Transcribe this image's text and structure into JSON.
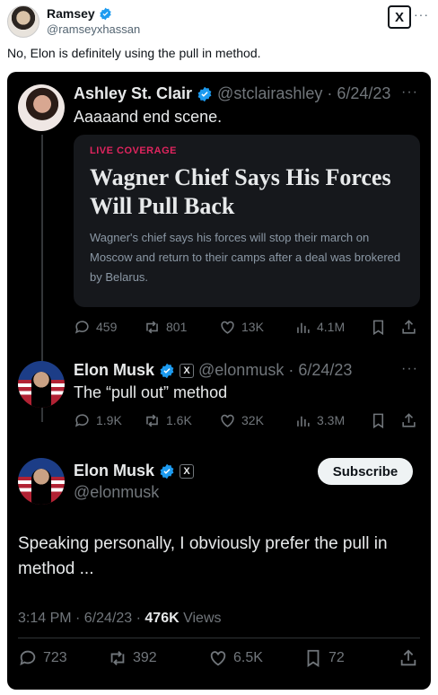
{
  "outer": {
    "name": "Ramsey",
    "handle": "@ramseyxhassan",
    "logo": "X",
    "text": "No, Elon is definitely using the pull in method."
  },
  "quoted_ashley": {
    "name": "Ashley St. Clair",
    "handle_date": "@stclairashley · 6/24/23",
    "text": "Aaaaand end scene.",
    "article": {
      "kicker": "LIVE COVERAGE",
      "title": "Wagner Chief Says His Forces Will Pull Back",
      "summary": "Wagner's chief says his forces will stop their march on Moscow and return to their camps after a deal was brokered by Belarus."
    },
    "stats": {
      "replies": "459",
      "reposts": "801",
      "likes": "13K",
      "views": "4.1M"
    }
  },
  "reply_elon": {
    "name": "Elon Musk",
    "handle_date": "@elonmusk · 6/24/23",
    "text": "The “pull out” method",
    "stats": {
      "replies": "1.9K",
      "reposts": "1.6K",
      "likes": "32K",
      "views": "3.3M"
    }
  },
  "main_elon": {
    "name": "Elon Musk",
    "handle": "@elonmusk",
    "subscribe_label": "Subscribe",
    "text": "Speaking personally, I obviously prefer the pull in method ...",
    "time_date": "3:14 PM · 6/24/23 · ",
    "views_count": "476K",
    "views_label": " Views",
    "stats": {
      "replies": "723",
      "reposts": "392",
      "likes": "6.5K",
      "bookmarks": "72"
    }
  },
  "colors": {
    "verified": "#1d9bf0",
    "dark_bg": "#000000",
    "muted": "#71767b",
    "kicker": "#e0245e"
  }
}
